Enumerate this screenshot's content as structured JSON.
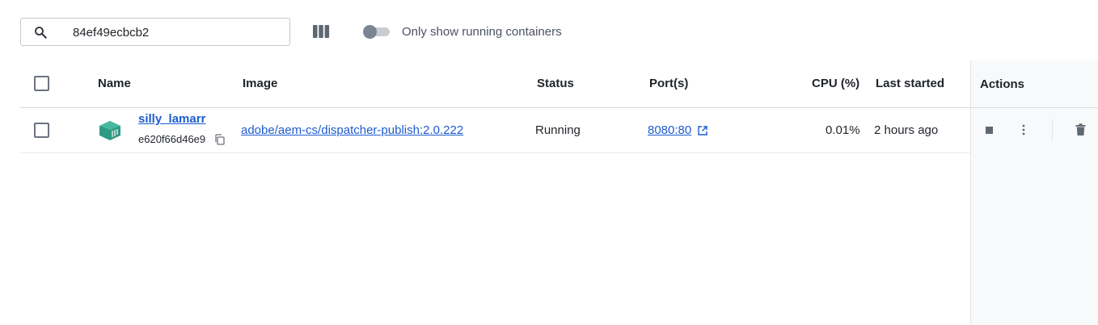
{
  "search": {
    "value": "84ef49ecbcb2",
    "placeholder": "Search"
  },
  "toolbar": {
    "running_only_label": "Only show running containers"
  },
  "table": {
    "columns": {
      "name": "Name",
      "image": "Image",
      "status": "Status",
      "ports": "Port(s)",
      "cpu": "CPU (%)",
      "last_started": "Last started",
      "actions": "Actions"
    },
    "rows": [
      {
        "name": "silly_lamarr",
        "id": "e620f66d46e9",
        "image": "adobe/aem-cs/dispatcher-publish:2.0.222",
        "status": "Running",
        "ports": "8080:80",
        "cpu": "0.01%",
        "last_started": "2 hours ago"
      }
    ]
  },
  "icons": {
    "search": "search-icon",
    "columns": "columns-icon",
    "container": "container-icon",
    "copy": "copy-icon",
    "external_link": "external-link-icon",
    "stop": "stop-icon",
    "more": "more-vertical-icon",
    "delete": "trash-icon"
  },
  "colors": {
    "link": "#1d5ccf",
    "container_icon": "#2e9a83",
    "toggle_knob": "#7a8593",
    "actions_bg": "#f8f9fb"
  }
}
